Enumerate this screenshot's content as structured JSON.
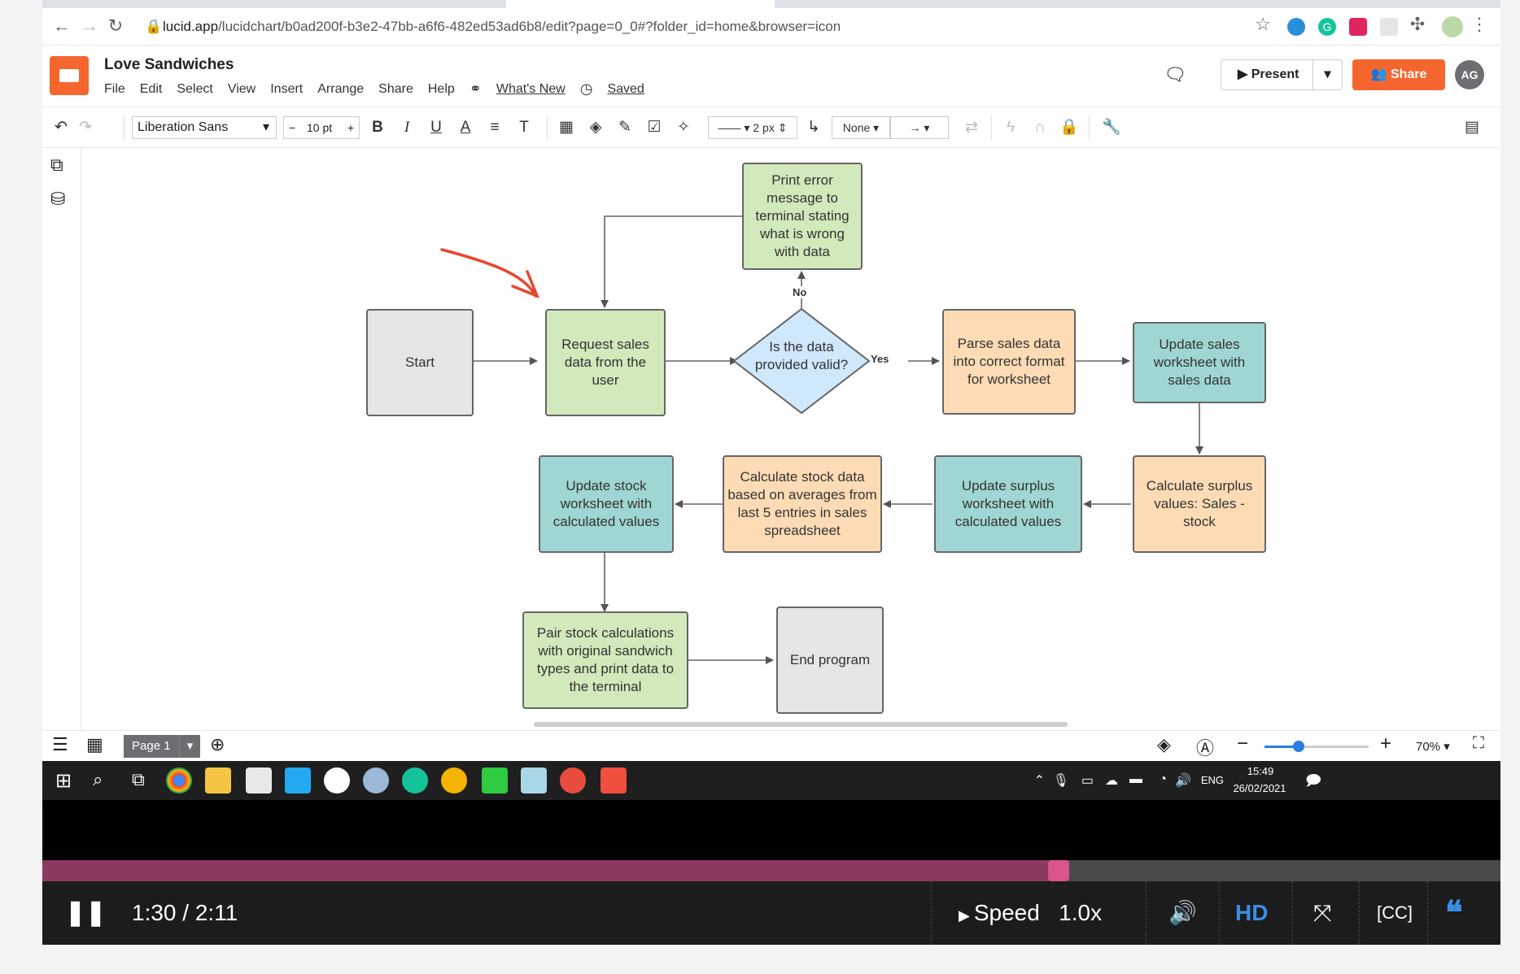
{
  "browser": {
    "url_host": "lucid.app",
    "url_path": "/lucidchart/b0ad200f-b3e2-47bb-a6f6-482ed53ad6b8/edit?page=0_0#?folder_id=home&browser=icon"
  },
  "app": {
    "doc_title": "Love Sandwiches",
    "menus": [
      "File",
      "Edit",
      "Select",
      "View",
      "Insert",
      "Arrange",
      "Share",
      "Help"
    ],
    "whats_new": "What's New",
    "saved": "Saved",
    "present_label": "Present",
    "share_label": "Share",
    "avatar_initials": "AG",
    "accent_color": "#f5662f"
  },
  "toolbar": {
    "font": "Liberation Sans",
    "font_size": "10 pt",
    "line_width": "2 px",
    "arrow_start": "None"
  },
  "diagram": {
    "nodes": {
      "start": "Start",
      "request": "Request sales data from the user",
      "decision": "Is the data provided valid?",
      "error": "Print error message to terminal stating what is wrong with data",
      "parse": "Parse sales data into correct format for worksheet",
      "update_sales": "Update sales worksheet with sales data",
      "calc_surplus": "Calculate surplus values: Sales - stock",
      "update_surplus": "Update surplus worksheet with calculated values",
      "calc_stock": "Calculate stock data based on averages from last 5 entries in sales spreadsheet",
      "update_stock": "Update stock worksheet with calculated values",
      "pair": "Pair stock calculations with original sandwich types and print data to the terminal",
      "end": "End program"
    },
    "edge_labels": {
      "no": "No",
      "yes": "Yes"
    },
    "colors": {
      "green": "#d1e9bb",
      "teal": "#9fd6d3",
      "orange": "#fddcb5",
      "gray": "#e6e6e6",
      "decision": "#cfe8fc",
      "annotation_arrow": "#e8472f"
    }
  },
  "bottom": {
    "page_tab": "Page 1",
    "zoom": "70%",
    "zoom_level": 0.33
  },
  "taskbar": {
    "language": "ENG",
    "time": "15:49",
    "date": "26/02/2021"
  },
  "video": {
    "time": "1:30 / 2:11",
    "speed_label": "Speed",
    "speed_value": "1.0x",
    "hd": "HD",
    "progress": 0.69
  }
}
